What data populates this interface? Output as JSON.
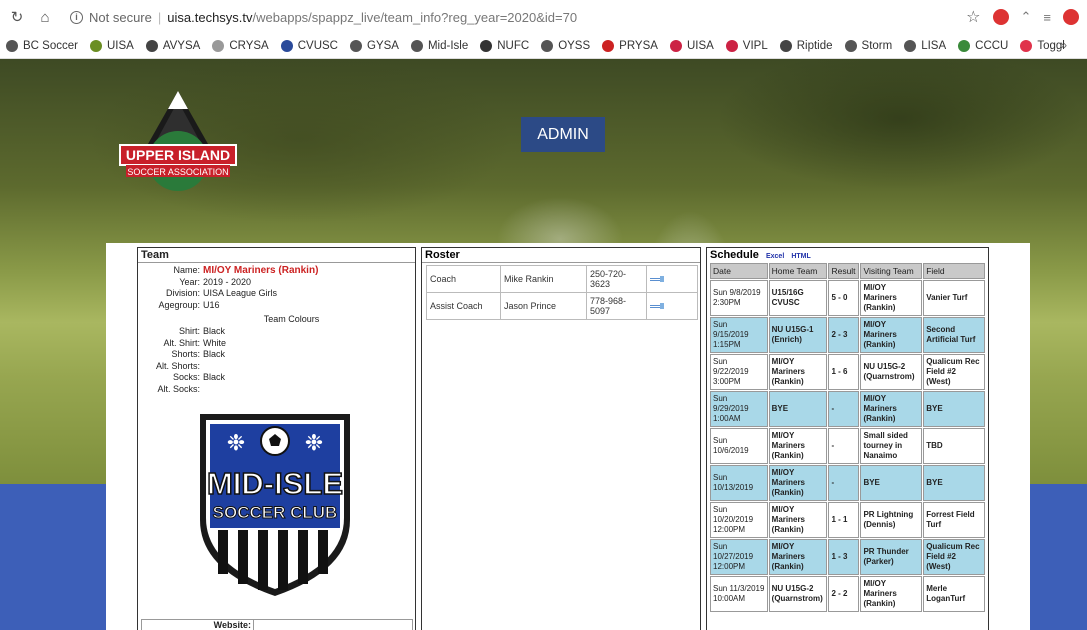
{
  "browser": {
    "security": "Not secure",
    "url_host": "uisa.techsys.tv",
    "url_path": "/webapps/spappz_live/team_info?reg_year=2020&id=70",
    "bookmarks": [
      {
        "label": "BC Soccer",
        "color": "#555555"
      },
      {
        "label": "UISA",
        "color": "#6b8e23"
      },
      {
        "label": "AVYSA",
        "color": "#444444"
      },
      {
        "label": "CRYSA",
        "color": "#999999"
      },
      {
        "label": "CVUSC",
        "color": "#2a4a9a"
      },
      {
        "label": "GYSA",
        "color": "#555555"
      },
      {
        "label": "Mid-Isle",
        "color": "#555555"
      },
      {
        "label": "NUFC",
        "color": "#333333"
      },
      {
        "label": "OYSS",
        "color": "#555555"
      },
      {
        "label": "PRYSA",
        "color": "#cc2222"
      },
      {
        "label": "UISA",
        "color": "#cc2244"
      },
      {
        "label": "VIPL",
        "color": "#cc2244"
      },
      {
        "label": "Riptide",
        "color": "#444444"
      },
      {
        "label": "Storm",
        "color": "#555555"
      },
      {
        "label": "LISA",
        "color": "#555555"
      },
      {
        "label": "CCCU",
        "color": "#3a8a3a"
      },
      {
        "label": "Toggl",
        "color": "#e0324b"
      }
    ],
    "more": "»"
  },
  "header": {
    "logo_text_top": "UPPER ISLAND",
    "logo_text_bottom": "SOCCER ASSOCIATION",
    "admin_label": "ADMIN"
  },
  "team": {
    "title": "Team",
    "name_label": "Name:",
    "name": "MI/OY Mariners (Rankin)",
    "year_label": "Year:",
    "year": "2019 - 2020",
    "division_label": "Division:",
    "division": "UISA League Girls",
    "agegroup_label": "Agegroup:",
    "agegroup": "U16",
    "colours_title": "Team Colours",
    "colours": [
      {
        "label": "Shirt:",
        "value": "Black"
      },
      {
        "label": "Alt. Shirt:",
        "value": "White"
      },
      {
        "label": "Shorts:",
        "value": "Black"
      },
      {
        "label": "Alt. Shorts:",
        "value": ""
      },
      {
        "label": "Socks:",
        "value": "Black"
      },
      {
        "label": "Alt. Socks:",
        "value": ""
      }
    ],
    "club_logo_top": "MID-ISLE",
    "club_logo_bottom": "SOCCER CLUB",
    "website_label": "Website:"
  },
  "roster": {
    "title": "Roster",
    "rows": [
      {
        "role": "Coach",
        "name": "Mike Rankin",
        "phone": "250-720-3623"
      },
      {
        "role": "Assist Coach",
        "name": "Jason Prince",
        "phone": "778-968-5097"
      }
    ]
  },
  "schedule": {
    "title": "Schedule",
    "excel": "Excel",
    "html": "HTML",
    "headers": [
      "Date",
      "Home Team",
      "Result",
      "Visiting Team",
      "Field"
    ],
    "rows": [
      {
        "date": "Sun 9/8/2019 2:30PM",
        "home": "U15/16G CVUSC",
        "result": "5 - 0",
        "visitor": "MI/OY Mariners (Rankin)",
        "field": "Vanier Turf"
      },
      {
        "date": "Sun 9/15/2019 1:15PM",
        "home": "NU U15G-1 (Enrich)",
        "result": "2 - 3",
        "visitor": "MI/OY Mariners (Rankin)",
        "field": "Second Artificial Turf"
      },
      {
        "date": "Sun 9/22/2019 3:00PM",
        "home": "MI/OY Mariners (Rankin)",
        "result": "1 - 6",
        "visitor": "NU U15G-2 (Quarnstrom)",
        "field": "Qualicum Rec Field #2 (West)"
      },
      {
        "date": "Sun 9/29/2019 1:00AM",
        "home": "BYE",
        "result": "-",
        "visitor": "MI/OY Mariners (Rankin)",
        "field": "BYE"
      },
      {
        "date": "Sun 10/6/2019",
        "home": "MI/OY Mariners (Rankin)",
        "result": "-",
        "visitor": "Small sided tourney in Nanaimo",
        "field": "TBD"
      },
      {
        "date": "Sun 10/13/2019",
        "home": "MI/OY Mariners (Rankin)",
        "result": "-",
        "visitor": "BYE",
        "field": "BYE"
      },
      {
        "date": "Sun 10/20/2019 12:00PM",
        "home": "MI/OY Mariners (Rankin)",
        "result": "1 - 1",
        "visitor": "PR Lightning (Dennis)",
        "field": "Forrest Field Turf"
      },
      {
        "date": "Sun 10/27/2019 12:00PM",
        "home": "MI/OY Mariners (Rankin)",
        "result": "1 - 3",
        "visitor": "PR Thunder (Parker)",
        "field": "Qualicum Rec Field #2 (West)"
      },
      {
        "date": "Sun 11/3/2019 10:00AM",
        "home": "NU U15G-2 (Quarnstrom)",
        "result": "2 - 2",
        "visitor": "MI/OY Mariners (Rankin)",
        "field": "Merle LoganTurf"
      }
    ]
  }
}
